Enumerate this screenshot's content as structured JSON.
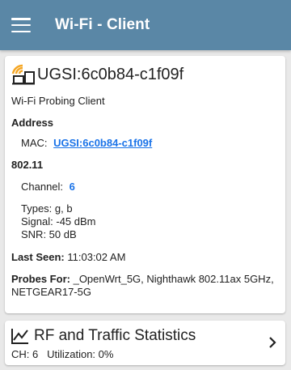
{
  "appbar": {
    "title": "Wi-Fi - Client"
  },
  "client": {
    "name": "UGSI:6c0b84-c1f09f",
    "subtitle": "Wi-Fi Probing Client",
    "address_label": "Address",
    "mac_label": "MAC:",
    "mac_value": "UGSI:6c0b84-c1f09f",
    "section_80211": "802.11",
    "channel_label": "Channel:",
    "channel_value": "6",
    "types": "Types: g, b",
    "signal": "Signal: -45 dBm",
    "snr": "SNR: 50 dB",
    "last_seen_label": "Last Seen:",
    "last_seen_value": "11:03:02 AM",
    "probes_label": "Probes For:",
    "probes_value": "_OpenWrt_5G, Nighthawk 802.11ax 5GHz, NETGEAR17-5G"
  },
  "rf_card": {
    "title": "RF and Traffic Statistics",
    "ch": "CH: 6",
    "utilization": "Utilization: 0%"
  },
  "colors": {
    "appbar": "#5a87a6",
    "link": "#1a73e8",
    "wifi_orange": "#f5a623"
  },
  "icons": [
    "menu-icon",
    "wifi-client-icon",
    "line-chart-icon",
    "chevron-right-icon"
  ]
}
